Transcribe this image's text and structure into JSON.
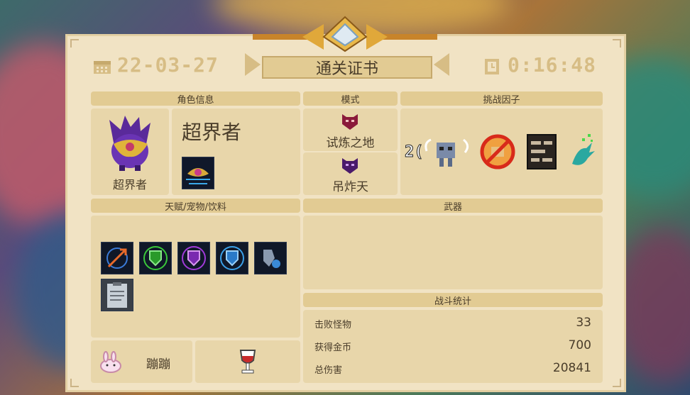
{
  "certificate": {
    "title": "通关证书",
    "date": "22-03-27",
    "time": "0:16:48"
  },
  "sections": {
    "role_info": "角色信息",
    "mode": "模式",
    "challenge": "挑战因子",
    "talents": "天赋/宠物/饮料",
    "weapons": "武器",
    "battle_stats": "战斗统计"
  },
  "character": {
    "name": "超界者",
    "caption": "超界者",
    "icon": "purple-flame-creature-icon",
    "skin_icon": "golden-eye-relic-icon"
  },
  "modes": [
    {
      "label": "试炼之地",
      "icon": "red-demon-mask-icon"
    },
    {
      "label": "吊炸天",
      "icon": "purple-demon-mask-icon"
    }
  ],
  "challenge_factors": [
    {
      "icon": "robot-enemy-icon",
      "text": "2("
    },
    {
      "icon": "no-fist-icon"
    },
    {
      "icon": "bookshelf-icon"
    },
    {
      "icon": "green-claw-icon"
    }
  ],
  "talents": [
    {
      "icon": "arrow-burst-icon"
    },
    {
      "icon": "green-shield-icon"
    },
    {
      "icon": "purple-shield-icon"
    },
    {
      "icon": "blue-shield-icon"
    },
    {
      "icon": "armor-piece-icon"
    },
    {
      "icon": "clipboard-icon"
    }
  ],
  "pet": {
    "name": "蹦蹦",
    "icon": "pink-bunny-icon"
  },
  "drink": {
    "icon": "red-wine-glass-icon"
  },
  "stats": [
    {
      "label": "击败怪物",
      "value": "33"
    },
    {
      "label": "获得金币",
      "value": "700"
    },
    {
      "label": "总伤害",
      "value": "20841"
    }
  ],
  "colors": {
    "card": "#f1e3c4",
    "pill": "#e2cb93",
    "panel": "#e8d6aa",
    "text": "#4a3d2a",
    "accent_gold": "#d7bd85"
  }
}
